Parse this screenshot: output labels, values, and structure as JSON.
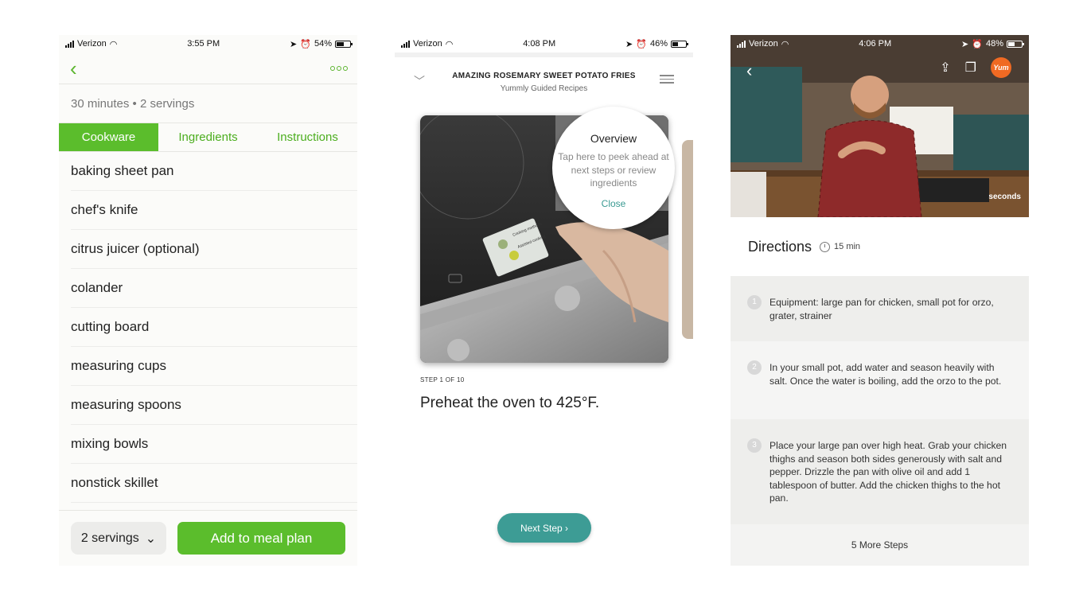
{
  "screen1": {
    "status": {
      "carrier": "Verizon",
      "time": "3:55 PM",
      "battery": "54%"
    },
    "meta": "30 minutes • 2 servings",
    "tabs": [
      "Cookware",
      "Ingredients",
      "Instructions"
    ],
    "items": [
      "baking sheet pan",
      "chef's knife",
      "citrus juicer (optional)",
      "colander",
      "cutting board",
      "measuring cups",
      "measuring spoons",
      "mixing bowls",
      "nonstick skillet"
    ],
    "servings_button": "2 servings",
    "add_button": "Add to meal plan"
  },
  "screen2": {
    "status": {
      "carrier": "Verizon",
      "time": "4:08 PM",
      "battery": "46%"
    },
    "title": "AMAZING ROSEMARY SWEET POTATO FRIES",
    "subtitle": "Yummly Guided Recipes",
    "overview": {
      "heading": "Overview",
      "text": "Tap here to peek ahead at next steps or review ingredients",
      "close": "Close"
    },
    "oven_screen_labels": [
      "Cooking methods",
      "Assisted cooking"
    ],
    "step_label": "STEP 1 OF 10",
    "instruction": "Preheat the oven to 425°F.",
    "next_button": "Next Step"
  },
  "screen3": {
    "status": {
      "carrier": "Verizon",
      "time": "4:06 PM",
      "battery": "48%"
    },
    "logo": "Yum",
    "brand": "seconds",
    "directions": "Directions",
    "time": "15 min",
    "steps": [
      {
        "n": "1",
        "text": "Equipment:  large pan for chicken, small pot for orzo, grater, strainer"
      },
      {
        "n": "2",
        "text": "In your small pot, add water and season heavily with salt.  Once the water is boiling, add the orzo to the pot."
      },
      {
        "n": "3",
        "text": "Place your large pan over high heat.  Grab your chicken thighs and season both sides generously with salt and pepper.  Drizzle the pan with olive oil and add 1 tablespoon of butter.  Add the chicken thighs to the hot pan."
      }
    ],
    "more_steps": "5 More Steps"
  }
}
